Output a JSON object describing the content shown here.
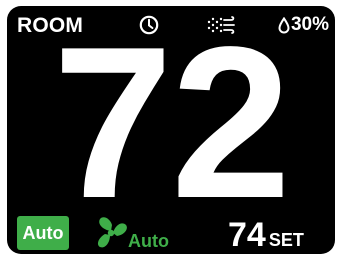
{
  "header": {
    "room_label": "ROOM",
    "schedule_icon": "clock-icon",
    "air_icon": "air-flow-icon",
    "humidity_icon": "water-drop-icon",
    "humidity": "30%"
  },
  "main": {
    "room_temperature": "72"
  },
  "footer": {
    "mode_label": "Auto",
    "fan_icon": "fan-icon",
    "fan_label": "Auto",
    "setpoint_value": "74",
    "setpoint_label": "SET"
  },
  "colors": {
    "background": "#000000",
    "text": "#ffffff",
    "accent_green": "#3fae49"
  }
}
